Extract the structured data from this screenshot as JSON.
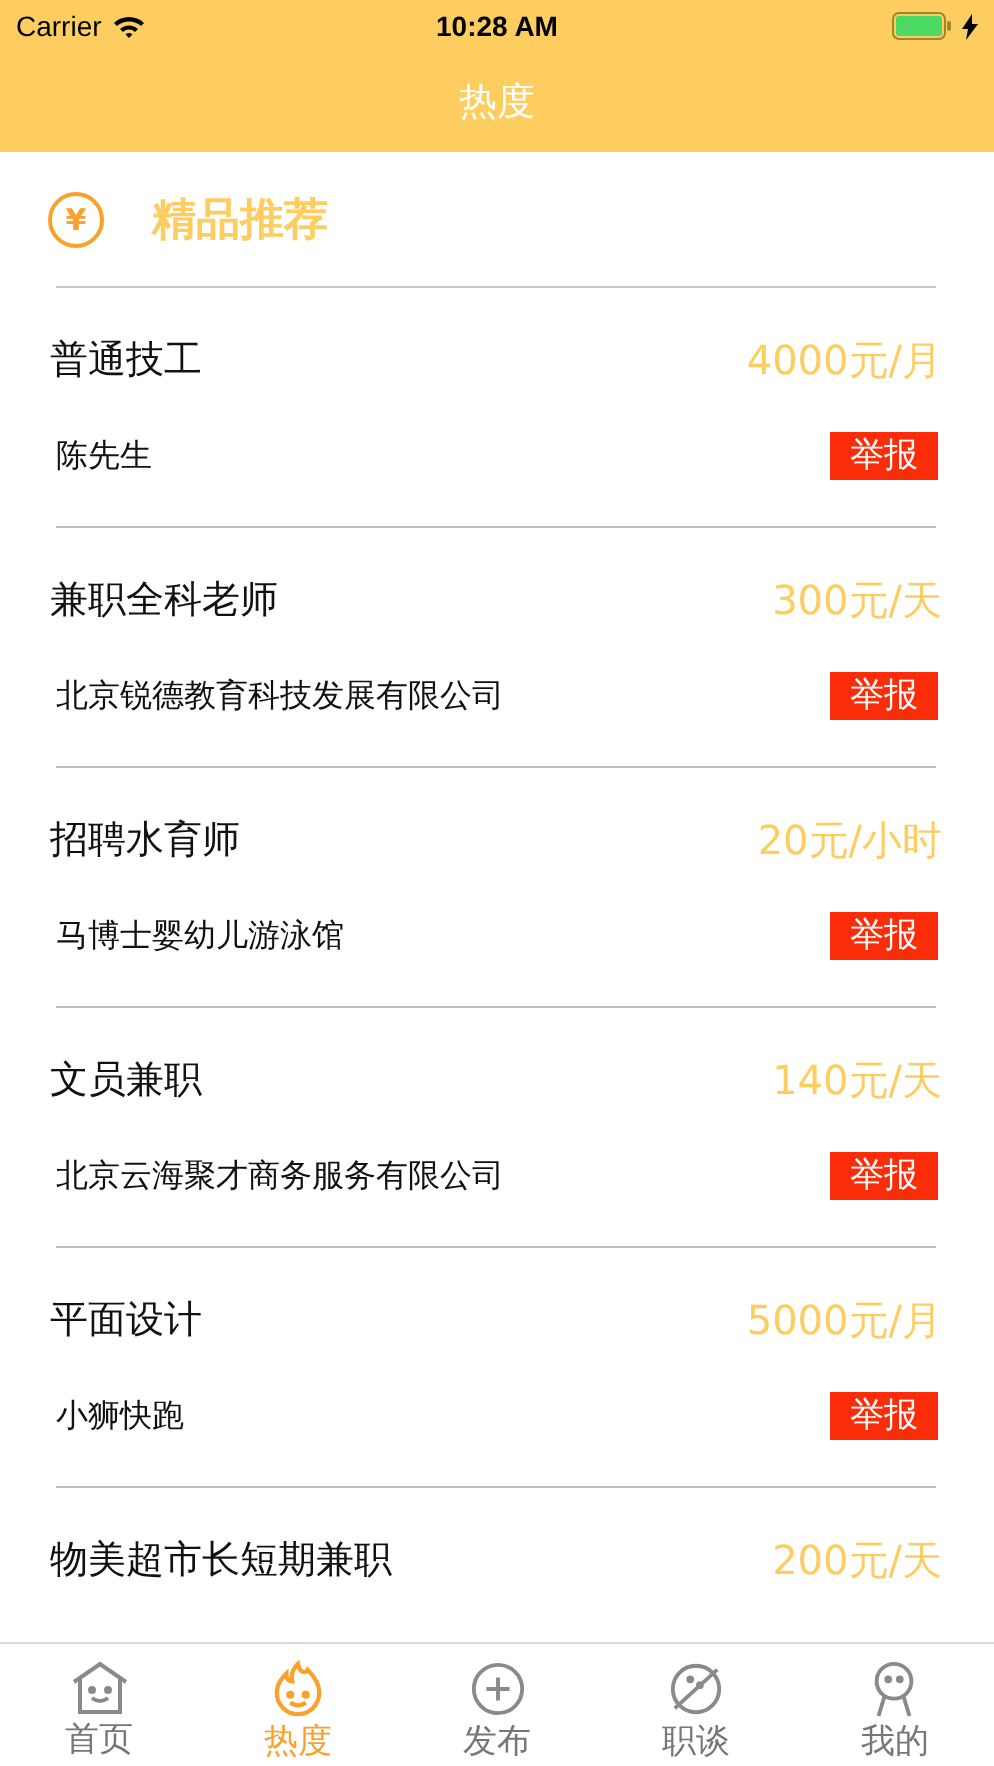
{
  "status_bar": {
    "carrier": "Carrier",
    "time": "10:28 AM"
  },
  "nav": {
    "title": "热度"
  },
  "section": {
    "icon": "¥",
    "title": "精品推荐"
  },
  "jobs": [
    {
      "title": "普通技工",
      "salary": "4000元/月",
      "company": "陈先生",
      "report": "举报"
    },
    {
      "title": "兼职全科老师",
      "salary": "300元/天",
      "company": "北京锐德教育科技发展有限公司",
      "report": "举报"
    },
    {
      "title": "招聘水育师",
      "salary": "20元/小时",
      "company": "马博士婴幼儿游泳馆",
      "report": "举报"
    },
    {
      "title": "文员兼职",
      "salary": "140元/天",
      "company": "北京云海聚才商务服务有限公司",
      "report": "举报"
    },
    {
      "title": "平面设计",
      "salary": "5000元/月",
      "company": "小狮快跑",
      "report": "举报"
    },
    {
      "title": "物美超市长短期兼职",
      "salary": "200元/天"
    }
  ],
  "tabs": [
    {
      "kind": "home",
      "label": "首页",
      "selected": false
    },
    {
      "kind": "fire",
      "label": "热度",
      "selected": true
    },
    {
      "kind": "plus",
      "label": "发布",
      "selected": false
    },
    {
      "kind": "planet",
      "label": "职谈",
      "selected": false
    },
    {
      "kind": "person",
      "label": "我的",
      "selected": false
    }
  ]
}
